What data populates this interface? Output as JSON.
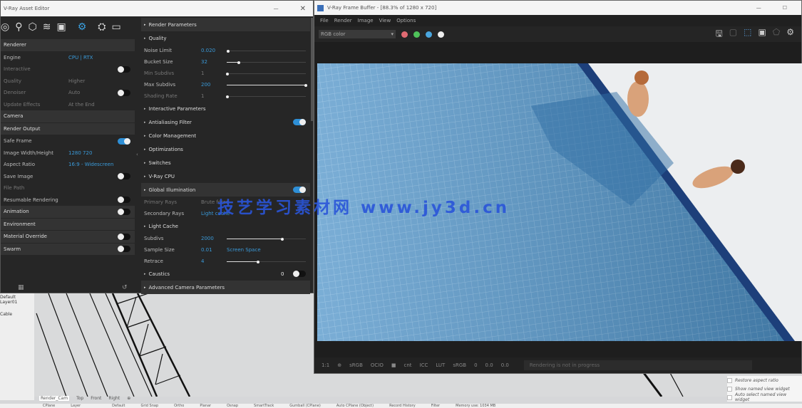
{
  "asset_editor": {
    "title": "V-Ray Asset Editor",
    "close": "✕",
    "minimize": "—",
    "left": [
      {
        "label": "Renderer",
        "type": "section"
      },
      {
        "label": "Engine",
        "value": "CPU | RTX",
        "type": "row"
      },
      {
        "label": "Interactive",
        "type": "toggle",
        "on": false,
        "dim": true
      },
      {
        "label": "Quality",
        "value": "Higher",
        "type": "row",
        "dim": true
      },
      {
        "label": "Denoiser",
        "value": "Auto",
        "type": "toggle",
        "on": false,
        "dim": true
      },
      {
        "label": "Update Effects",
        "value": "At the End",
        "type": "row",
        "dim": true
      },
      {
        "label": "Camera",
        "type": "section"
      },
      {
        "label": "Render Output",
        "type": "section"
      },
      {
        "label": "Safe Frame",
        "type": "toggle",
        "on": true
      },
      {
        "label": "Image Width/Height",
        "value": "1280     720",
        "type": "row"
      },
      {
        "label": "Aspect Ratio",
        "value": "16:9 - Widescreen",
        "type": "row"
      },
      {
        "label": "Save Image",
        "type": "toggle",
        "on": false
      },
      {
        "label": "File Path",
        "type": "row",
        "dim": true
      },
      {
        "label": "Resumable Rendering",
        "type": "toggle",
        "on": false
      },
      {
        "label": "Animation",
        "type": "section-toggle",
        "on": false
      },
      {
        "label": "Environment",
        "type": "section"
      },
      {
        "label": "Material Override",
        "type": "section-toggle",
        "on": false
      },
      {
        "label": "Swarm",
        "type": "section-toggle",
        "on": false
      }
    ],
    "right": [
      {
        "label": "Render Parameters",
        "type": "section"
      },
      {
        "label": "Quality",
        "type": "head"
      },
      {
        "label": "Noise Limit",
        "value": "0.020",
        "slider": 0.02
      },
      {
        "label": "Bucket Size",
        "value": "32",
        "slider": 0.15
      },
      {
        "label": "Min Subdivs",
        "value": "1",
        "slider": 0.01,
        "dim": true
      },
      {
        "label": "Max Subdivs",
        "value": "200",
        "slider": 1
      },
      {
        "label": "Shading Rate",
        "value": "1",
        "slider": 0.01,
        "dim": true
      },
      {
        "label": "Interactive Parameters",
        "type": "head"
      },
      {
        "label": "Antialiasing Filter",
        "type": "head",
        "toggle": true
      },
      {
        "label": "Color Management",
        "type": "head"
      },
      {
        "label": "Optimizations",
        "type": "head"
      },
      {
        "label": "Switches",
        "type": "head"
      },
      {
        "label": "V-Ray CPU",
        "type": "head"
      },
      {
        "label": "Global Illumination",
        "type": "section",
        "toggle": true
      },
      {
        "label": "Primary Rays",
        "value": "Brute force",
        "dim": true
      },
      {
        "label": "Secondary Rays",
        "value": "Light cache"
      },
      {
        "label": "Light Cache",
        "type": "head"
      },
      {
        "label": "Subdivs",
        "value": "2000",
        "slider": 0.7
      },
      {
        "label": "Sample Size",
        "value": "0.01",
        "value2": "Screen Space"
      },
      {
        "label": "Retrace",
        "value": "4",
        "slider": 0.4
      },
      {
        "label": "Caustics",
        "type": "head",
        "value": "0",
        "toggle": false
      },
      {
        "label": "Advanced Camera Parameters",
        "type": "section"
      }
    ]
  },
  "frame_buffer": {
    "title": "V-Ray Frame Buffer - [88.3% of 1280 x 720]",
    "menu": [
      "File",
      "Render",
      "Image",
      "View",
      "Options"
    ],
    "channel": "RGB color",
    "colors": {
      "red": "#e06a72",
      "green": "#4fc25a",
      "blue": "#4aa6df"
    },
    "bottom": [
      "1:1",
      "⊕",
      "sRGB",
      "OCIO",
      "■",
      "cnt",
      "ICC",
      "LUT",
      "sRGB",
      "0",
      "0.0",
      "0.0"
    ],
    "status": "Rendering is not in progress"
  },
  "viewport": {
    "tabs": [
      "Render_Cam",
      "Top",
      "Front",
      "Right",
      "⊕"
    ],
    "layers": [
      "Default",
      "Layer01",
      "Cable"
    ],
    "status": [
      "CPlane",
      "Layer",
      "",
      "Default",
      "Grid Snap",
      "Ortho",
      "Planar",
      "Osnap",
      "SmartTrack",
      "Gumball (CPlane)",
      "Auto CPlane (Object)",
      "Record History",
      "Filter",
      "Memory use: 1034 MB"
    ],
    "options": [
      "Restore aspect ratio",
      "Show named view widget",
      "Auto select named view widget"
    ]
  },
  "watermark": "技艺学习素材网  www.jy3d.cn"
}
